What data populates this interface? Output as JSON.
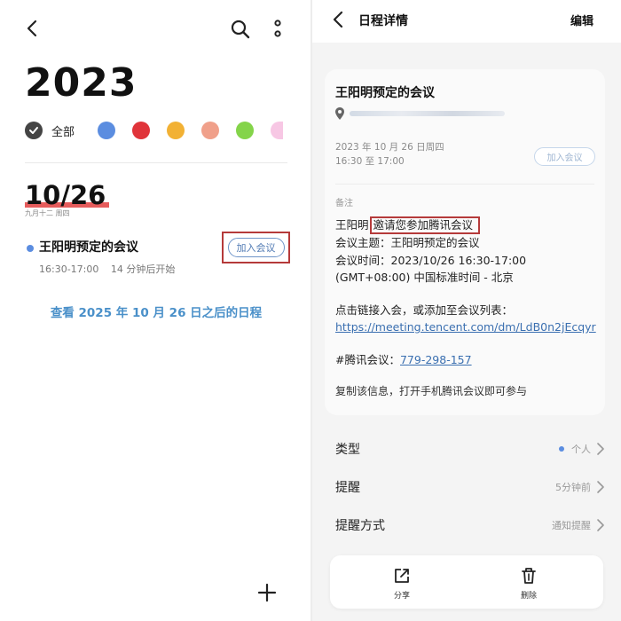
{
  "left": {
    "year": "2023",
    "filter_all_label": "全部",
    "filter_colors": [
      "#5b8de0",
      "#e0343a",
      "#f2b134",
      "#f0a08a",
      "#84d44a",
      "#f7c7e4"
    ],
    "date": "10/26",
    "lunar": "九月十二 周四",
    "event": {
      "title": "王阳明预定的会议",
      "time": "16:30-17:00",
      "relative": "14 分钟后开始",
      "join_label": "加入会议",
      "dot_color": "#5b8de0"
    },
    "view_later": "查看 2025 年 10 月 26 日之后的日程"
  },
  "right": {
    "header_title": "日程详情",
    "edit_label": "编辑",
    "card": {
      "title": "王阳明预定的会议",
      "date_line": "2023 年 10 月 26 日周四",
      "time_line": "16:30 至 17:00",
      "join_label": "加入会议",
      "note_label": "备注",
      "body_prefix": "王阳明",
      "invite_text": "邀请您参加腾讯会议",
      "topic_line": "会议主题：王阳明预定的会议",
      "time_detail": "会议时间：2023/10/26 16:30-17:00",
      "timezone": "(GMT+08:00) 中国标准时间 - 北京",
      "link_prompt": "点击链接入会，或添加至会议列表：",
      "link_url": "https://meeting.tencent.com/dm/LdB0n2jEcqyr",
      "meeting_id_label": "#腾讯会议：",
      "meeting_id": "779-298-157",
      "footer": "复制该信息，打开手机腾讯会议即可参与"
    },
    "rows": [
      {
        "label": "类型",
        "value": "个人"
      },
      {
        "label": "提醒",
        "value": "5分钟前"
      },
      {
        "label": "提醒方式",
        "value": "通知提醒"
      }
    ],
    "bottom": {
      "share_label": "分享",
      "delete_label": "删除"
    }
  }
}
